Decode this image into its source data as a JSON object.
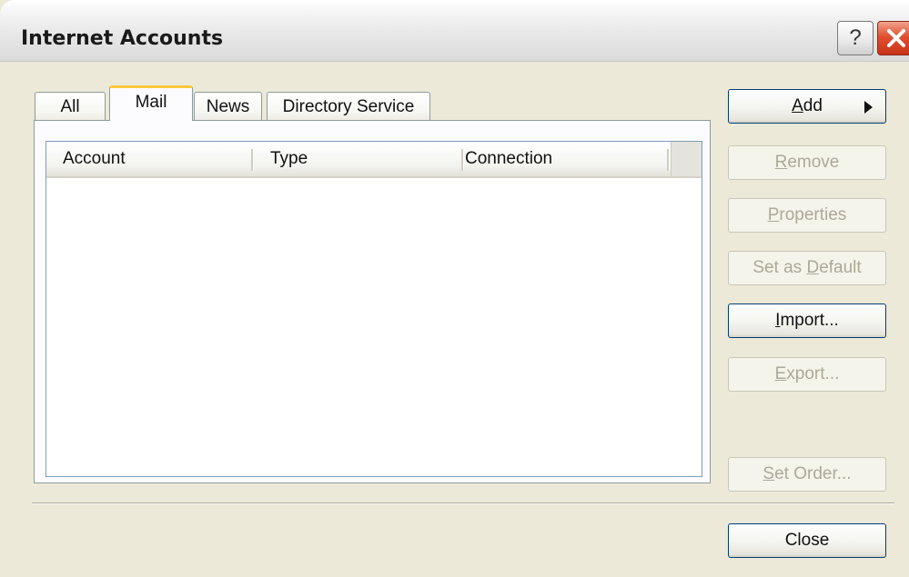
{
  "window": {
    "title": "Internet Accounts"
  },
  "titlebar_buttons": {
    "help_glyph": "?",
    "close_icon": "close-icon",
    "help_icon": "help-icon"
  },
  "tabs": [
    {
      "label": "All",
      "selected": false
    },
    {
      "label": "Mail",
      "selected": true
    },
    {
      "label": "News",
      "selected": false
    },
    {
      "label": "Directory Service",
      "selected": false
    }
  ],
  "list": {
    "columns": [
      "Account",
      "Type",
      "Connection"
    ],
    "rows": []
  },
  "buttons": {
    "add": {
      "label": "Add",
      "accel": "A",
      "rest": "dd",
      "enabled": true
    },
    "remove": {
      "label": "Remove",
      "accel": "R",
      "rest": "emove",
      "enabled": false
    },
    "properties": {
      "label": "Properties",
      "accel": "P",
      "rest": "roperties",
      "enabled": false
    },
    "set_default": {
      "label": "Set as Default",
      "pre": "Set as ",
      "accel": "D",
      "rest": "efault",
      "enabled": false
    },
    "import": {
      "label": "Import...",
      "accel": "I",
      "rest": "mport...",
      "enabled": true
    },
    "export": {
      "label": "Export...",
      "accel": "E",
      "rest": "xport...",
      "enabled": false
    },
    "set_order": {
      "label": "Set Order...",
      "accel": "S",
      "rest": "et Order...",
      "enabled": false
    },
    "close": {
      "label": "Close",
      "enabled": true
    }
  },
  "colors": {
    "window_bg": "#ece9d8",
    "selected_tab_accent": "#ffc83c",
    "close_button_red": "#e0502f",
    "button_border": "#003c74",
    "disabled_text": "#aca899"
  }
}
